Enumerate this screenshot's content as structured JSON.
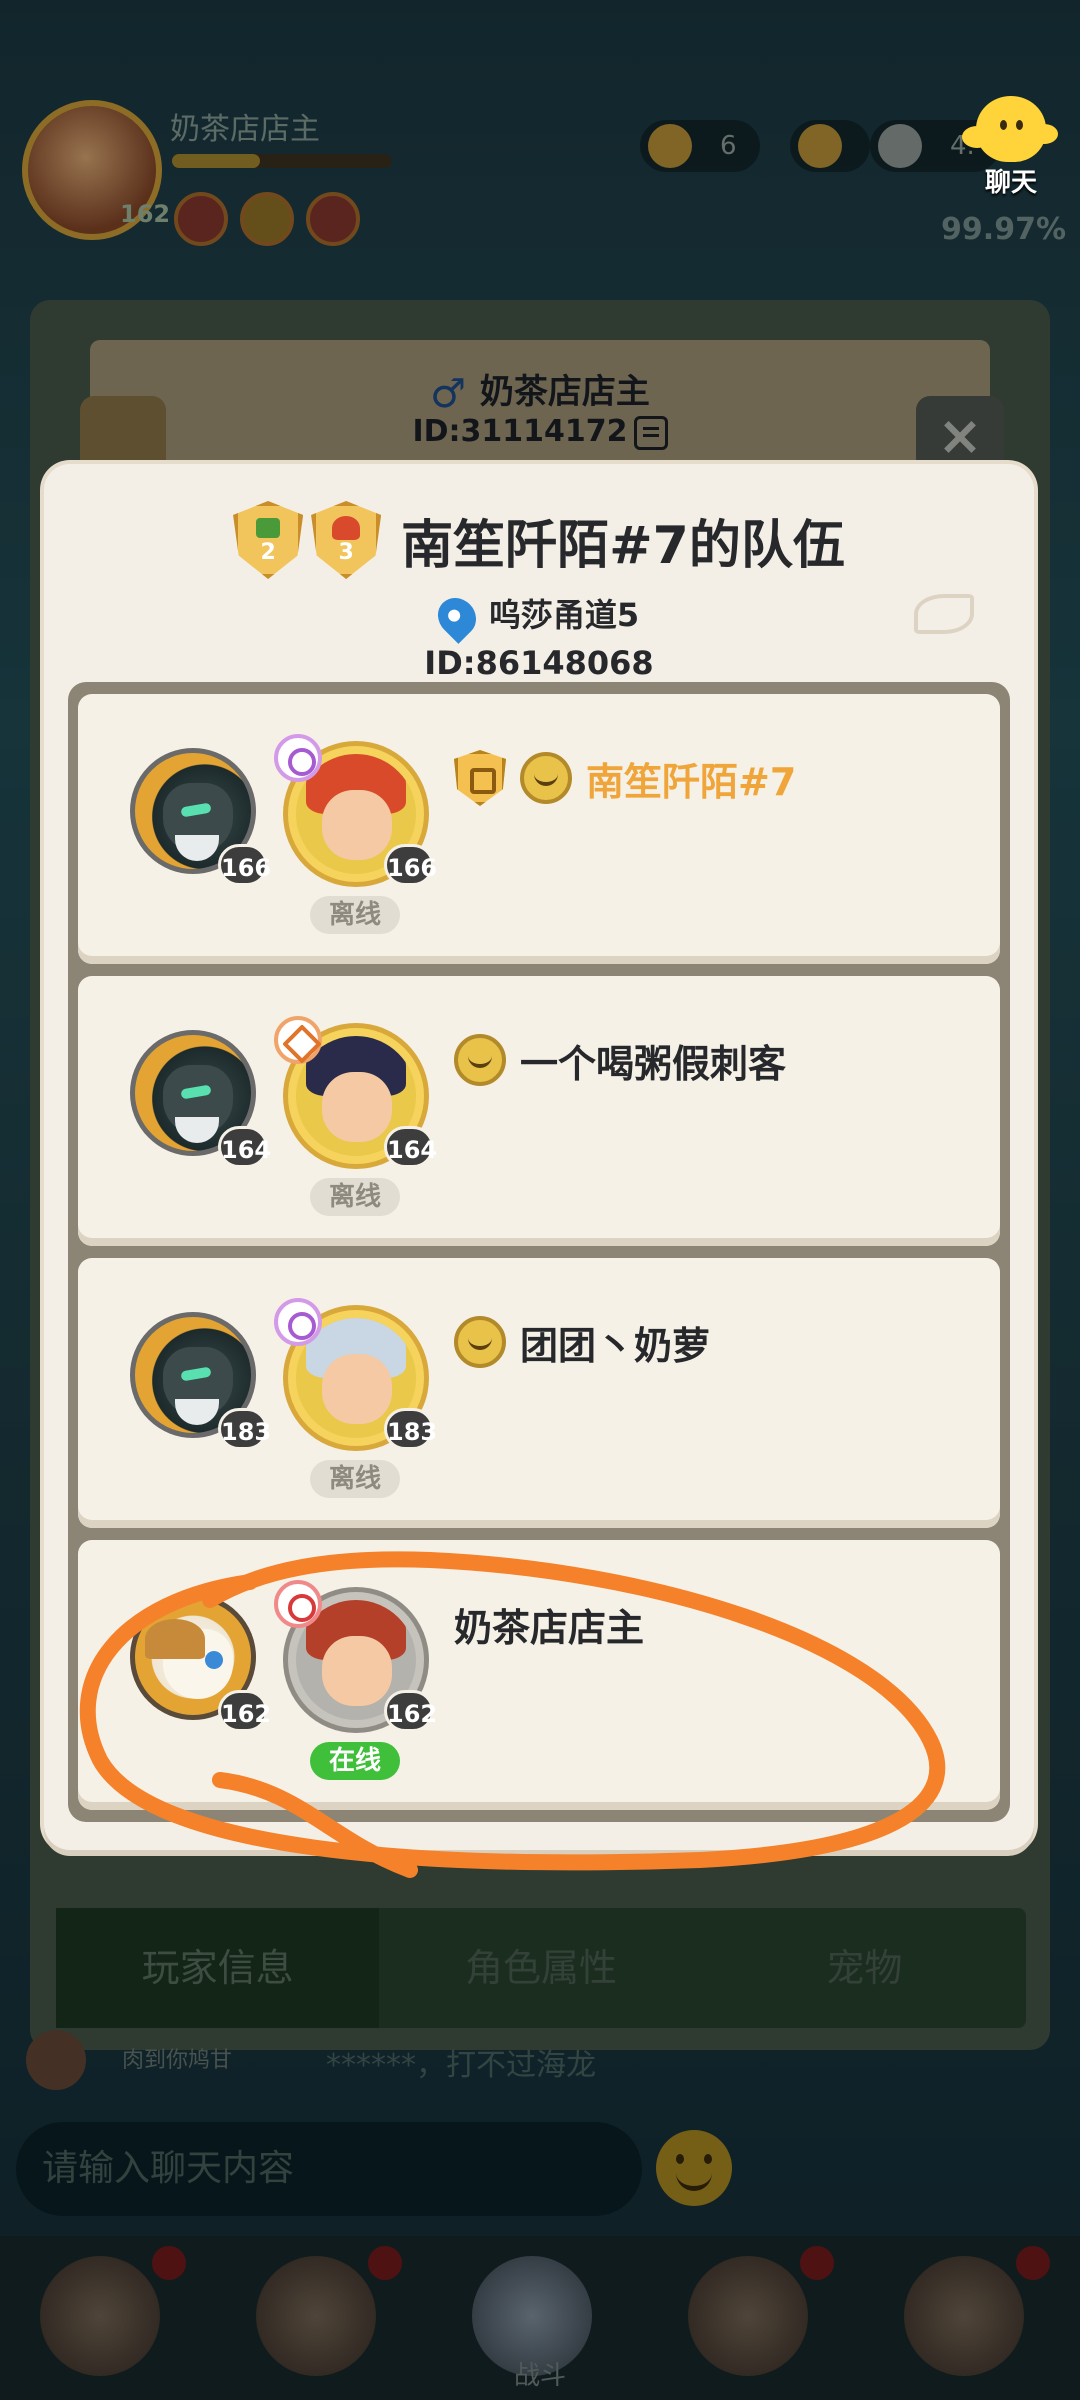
{
  "background": {
    "player_name": "奶茶店店主",
    "player_level": "162",
    "resource_1": "6",
    "resource_2": "4.",
    "percent": "99.97%",
    "tabs": [
      "玩家信息",
      "角色属性",
      "宠物"
    ],
    "feed_user": "肉到你鸠甘",
    "feed_text": "******，打不过海龙",
    "chat_placeholder": "请输入聊天内容",
    "nav_center_label": "战斗"
  },
  "chat_button": {
    "label": "聊天",
    "icon": "chat-bubble-icon"
  },
  "profile_header": {
    "name": "奶茶店店主",
    "id": "ID:31114172",
    "gender_icon": "male-icon",
    "close_label": "×"
  },
  "team": {
    "badge_1_level": "2",
    "badge_2_level": "3",
    "title": "南笙阡陌#7的队伍",
    "location": "呜莎甬道5",
    "id": "ID:86148068"
  },
  "members": [
    {
      "name": "南笙阡陌#7",
      "pet_level": "166",
      "hero_level": "166",
      "status": "离线",
      "is_leader": true,
      "online": false
    },
    {
      "name": "一个喝粥假刺客",
      "pet_level": "164",
      "hero_level": "164",
      "status": "离线",
      "is_leader": false,
      "online": false
    },
    {
      "name": "团团丶奶萝",
      "pet_level": "183",
      "hero_level": "183",
      "status": "离线",
      "is_leader": false,
      "online": false
    },
    {
      "name": "奶茶店店主",
      "pet_level": "162",
      "hero_level": "162",
      "status": "在线",
      "is_leader": false,
      "online": true
    }
  ],
  "colors": {
    "leader_name": "#f0a53a",
    "online_pill": "#3fbf3a",
    "annotation_circle": "#f5822a"
  }
}
